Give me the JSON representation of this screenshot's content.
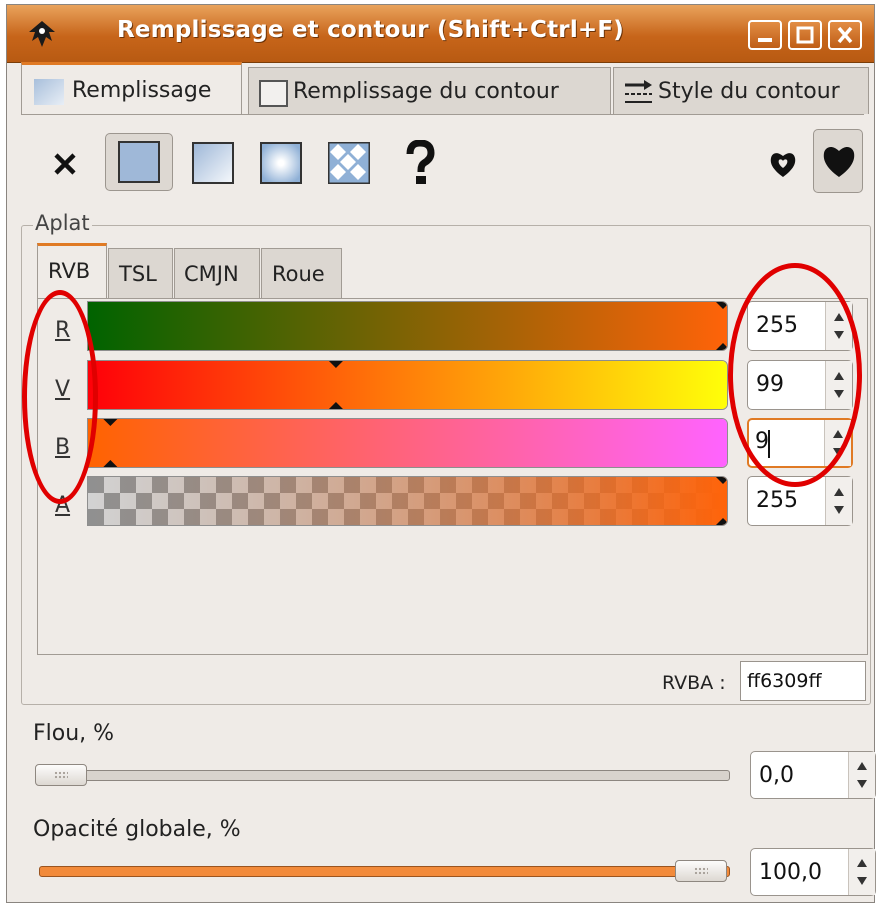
{
  "window": {
    "title": "Remplissage et contour (Shift+Ctrl+F)",
    "buttons": [
      "minimize",
      "maximize",
      "close"
    ]
  },
  "tabs": [
    {
      "label": "Remplissage",
      "active": true,
      "icon": "flat-fill-swatch-icon"
    },
    {
      "label": "Remplissage du contour",
      "active": false,
      "icon": "empty-stroke-swatch-icon"
    },
    {
      "label": "Style du contour",
      "active": false,
      "icon": "stroke-style-lines-icon"
    }
  ],
  "fill_modes": [
    {
      "name": "none",
      "icon": "x-icon",
      "pressed": false
    },
    {
      "name": "flat",
      "icon": "flat-color-icon",
      "pressed": true
    },
    {
      "name": "linear-gradient",
      "icon": "linear-gradient-icon",
      "pressed": false
    },
    {
      "name": "radial-gradient",
      "icon": "radial-gradient-icon",
      "pressed": false
    },
    {
      "name": "pattern",
      "icon": "pattern-icon",
      "pressed": false
    },
    {
      "name": "unset",
      "icon": "question-mark-icon",
      "pressed": false
    }
  ],
  "fill_rules": [
    {
      "name": "evenodd",
      "icon": "evenodd-fill-rule-icon",
      "pressed": false
    },
    {
      "name": "nonzero",
      "icon": "nonzero-fill-rule-icon",
      "pressed": true
    }
  ],
  "flat_frame": {
    "label": "Aplat"
  },
  "color_tabs": [
    {
      "label": "RVB",
      "active": true
    },
    {
      "label": "TSL",
      "active": false
    },
    {
      "label": "CMJN",
      "active": false
    },
    {
      "label": "Roue",
      "active": false
    }
  ],
  "channels": [
    {
      "label": "R",
      "value": "255",
      "level": 1.0,
      "gradient": [
        "#006300",
        "#ff6309"
      ]
    },
    {
      "label": "V",
      "value": "99",
      "level": 0.388,
      "gradient": [
        "#ff0009",
        "#ffff09"
      ]
    },
    {
      "label": "B",
      "value": "9",
      "level": 0.035,
      "gradient": [
        "#ff6300",
        "#ff63ff"
      ],
      "editing": true
    },
    {
      "label": "A",
      "value": "255",
      "level": 1.0,
      "gradient": [
        "#808080",
        "#ff6309"
      ]
    }
  ],
  "rvba": {
    "label": "RVBA :",
    "value": "ff6309ff"
  },
  "blur": {
    "label": "Flou, %",
    "value": "0,0",
    "level": 0.0
  },
  "opacity": {
    "label": "Opacité globale, %",
    "value": "100,0",
    "level": 1.0
  },
  "colors": {
    "accent": "#e07a24",
    "current_color": "#ff6309",
    "annotation": "#e00000"
  }
}
